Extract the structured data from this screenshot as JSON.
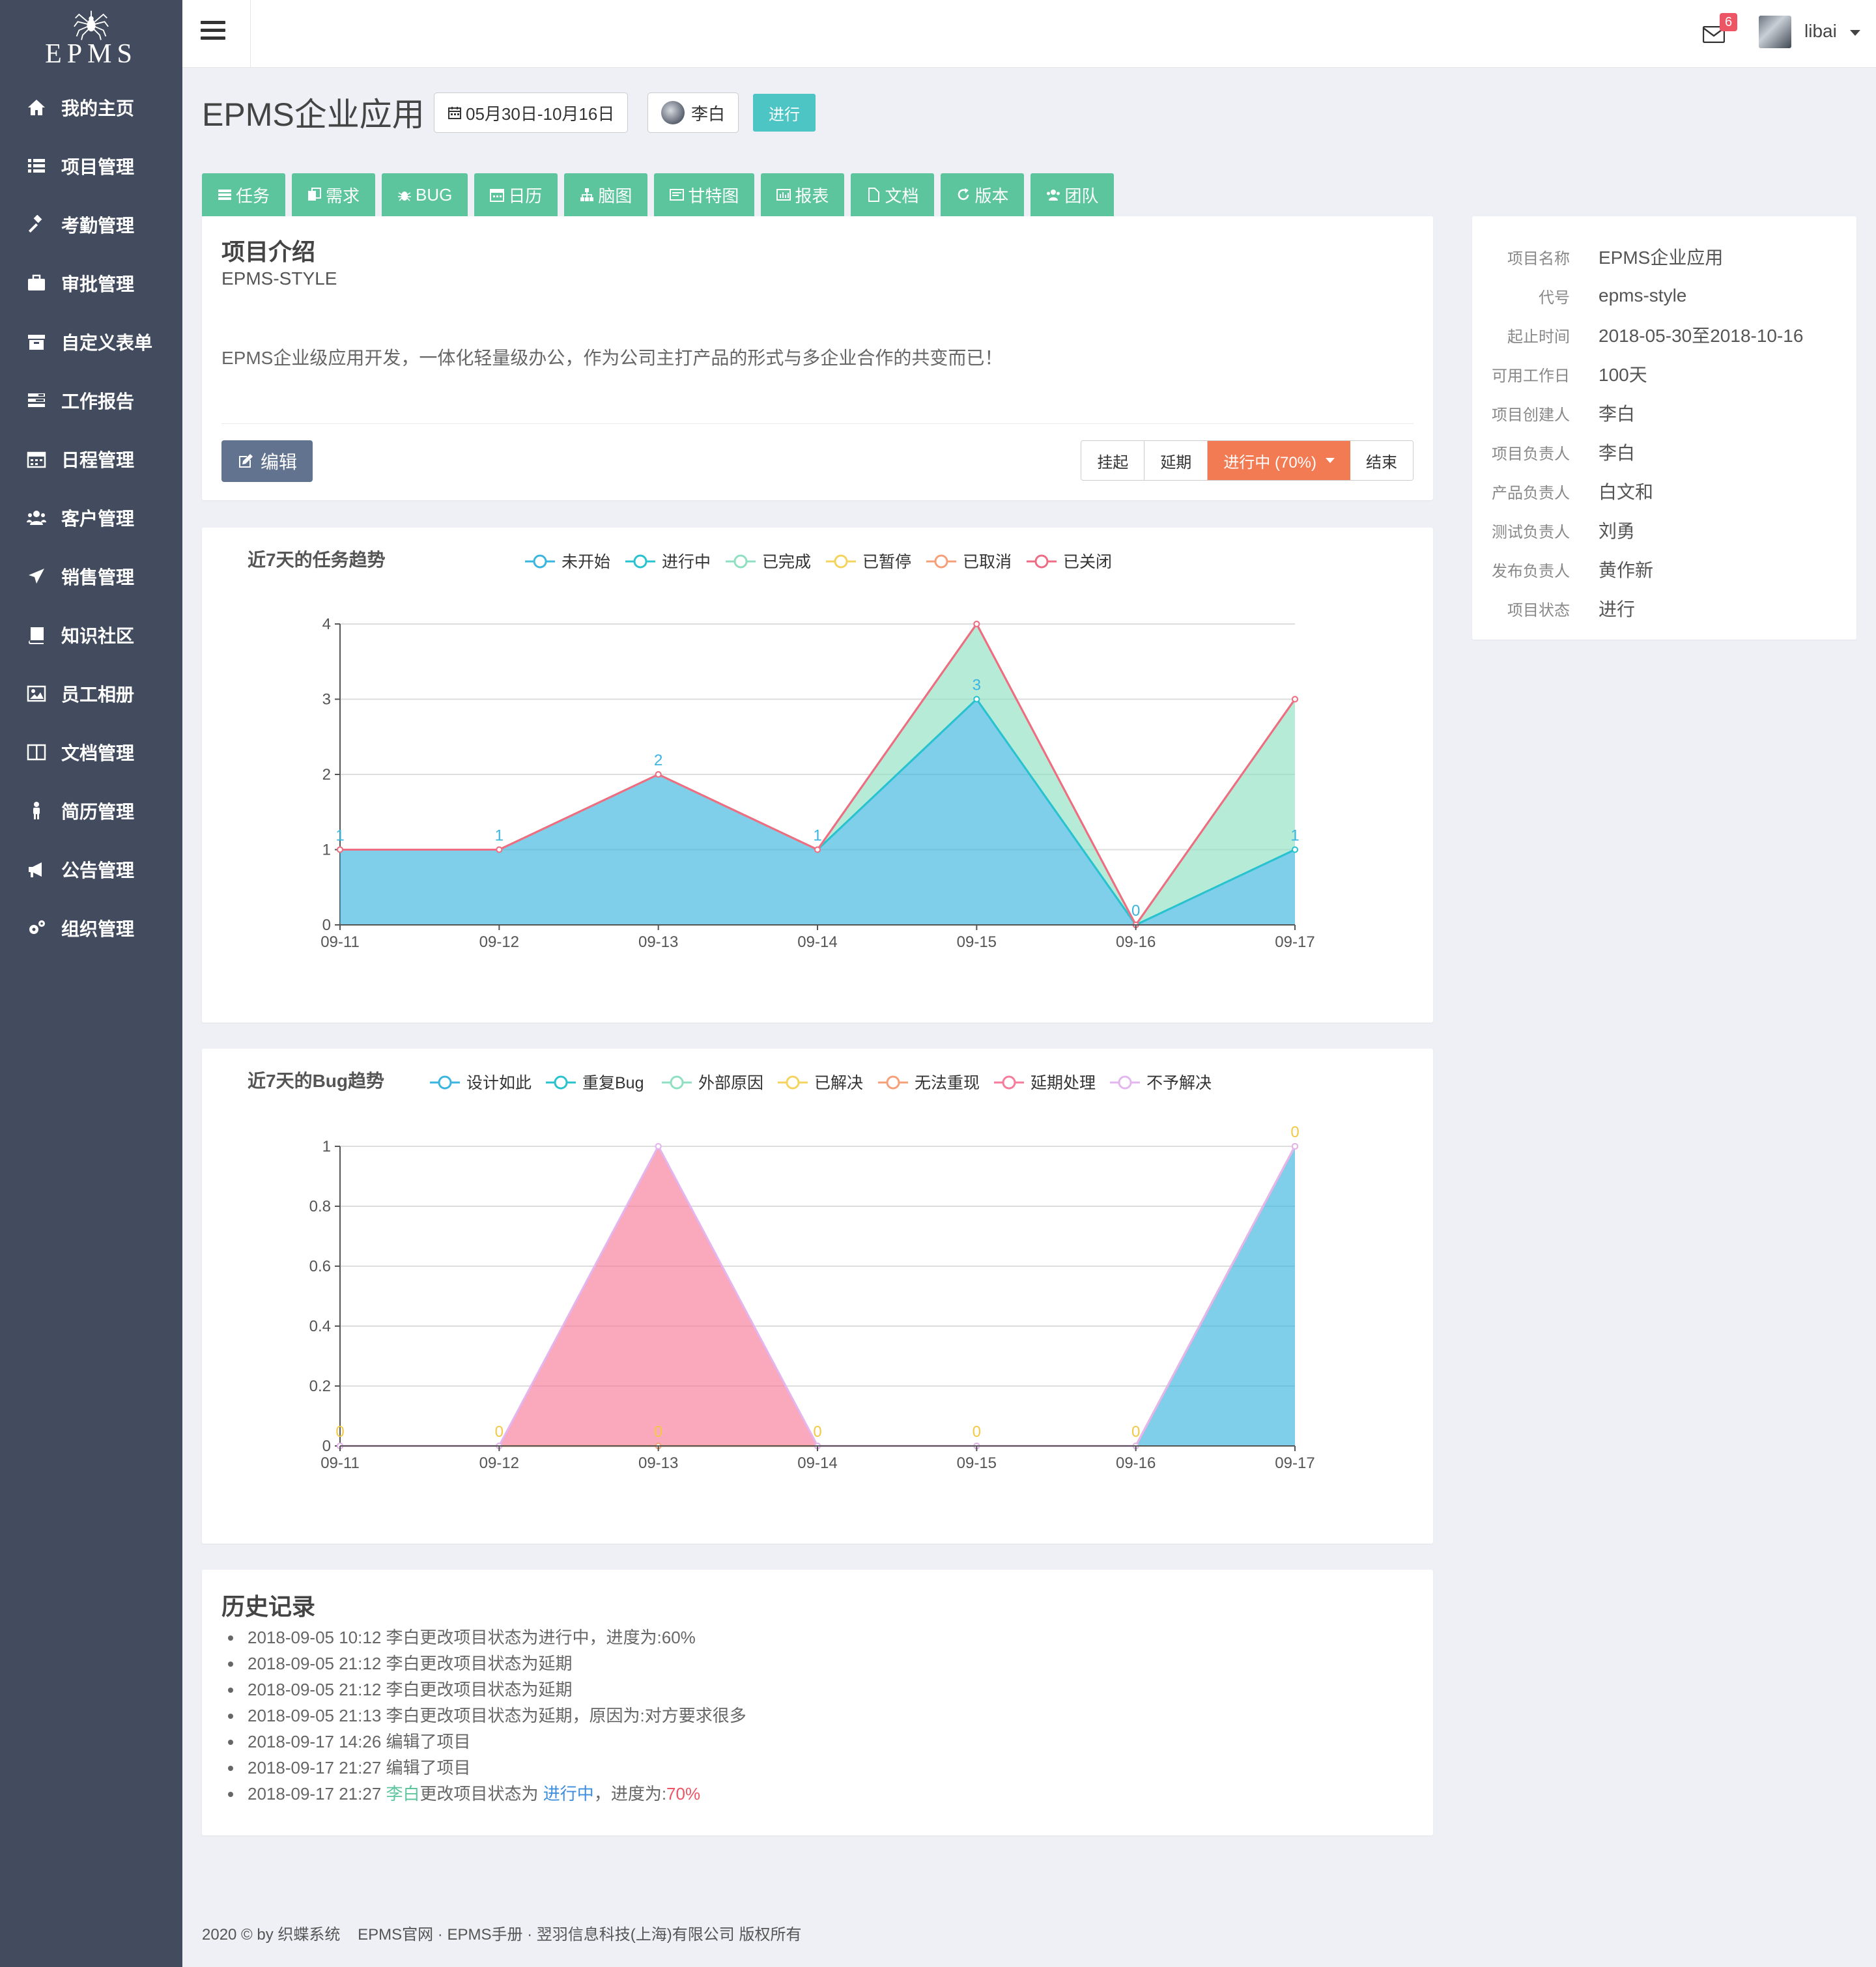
{
  "brand": {
    "logo_text": "EPMS"
  },
  "sidebar": {
    "items": [
      {
        "label": "我的主页",
        "icon": "home-icon"
      },
      {
        "label": "项目管理",
        "icon": "list-icon"
      },
      {
        "label": "考勤管理",
        "icon": "gavel-icon"
      },
      {
        "label": "审批管理",
        "icon": "briefcase-icon"
      },
      {
        "label": "自定义表单",
        "icon": "archive-icon"
      },
      {
        "label": "工作报告",
        "icon": "tasks-icon"
      },
      {
        "label": "日程管理",
        "icon": "calendar-icon"
      },
      {
        "label": "客户管理",
        "icon": "users-icon"
      },
      {
        "label": "销售管理",
        "icon": "plane-icon"
      },
      {
        "label": "知识社区",
        "icon": "book-icon"
      },
      {
        "label": "员工相册",
        "icon": "image-icon"
      },
      {
        "label": "文档管理",
        "icon": "columns-icon"
      },
      {
        "label": "简历管理",
        "icon": "person-icon"
      },
      {
        "label": "公告管理",
        "icon": "bullhorn-icon"
      },
      {
        "label": "组织管理",
        "icon": "cogs-icon"
      }
    ]
  },
  "header": {
    "mail_count": "6",
    "username": "libai"
  },
  "project": {
    "title": "EPMS企业应用",
    "date_range": "05月30日-10月16日",
    "owner": "李白",
    "status": "进行"
  },
  "tabs": [
    {
      "label": "任务",
      "icon": "task-icon"
    },
    {
      "label": "需求",
      "icon": "copy-icon"
    },
    {
      "label": "BUG",
      "icon": "bug-icon"
    },
    {
      "label": "日历",
      "icon": "calendar-icon"
    },
    {
      "label": "脑图",
      "icon": "sitemap-icon"
    },
    {
      "label": "甘特图",
      "icon": "gantt-icon"
    },
    {
      "label": "报表",
      "icon": "bar-chart-icon"
    },
    {
      "label": "文档",
      "icon": "file-icon"
    },
    {
      "label": "版本",
      "icon": "refresh-icon"
    },
    {
      "label": "团队",
      "icon": "team-icon"
    }
  ],
  "intro": {
    "heading": "项目介绍",
    "code": "EPMS-STYLE",
    "description": "EPMS企业级应用开发，一体化轻量级办公，作为公司主打产品的形式与多企业合作的共变而已！",
    "edit_label": "编辑",
    "status_buttons": {
      "suspend": "挂起",
      "delay": "延期",
      "in_progress": "进行中  (70%)",
      "finish": "结束"
    }
  },
  "info": [
    {
      "key": "项目名称",
      "value": "EPMS企业应用"
    },
    {
      "key": "代号",
      "value": "epms-style"
    },
    {
      "key": "起止时间",
      "value": "2018-05-30至2018-10-16"
    },
    {
      "key": "可用工作日",
      "value": "100天"
    },
    {
      "key": "项目创建人",
      "value": "李白"
    },
    {
      "key": "项目负责人",
      "value": "李白"
    },
    {
      "key": "产品负责人",
      "value": "白文和"
    },
    {
      "key": "测试负责人",
      "value": "刘勇"
    },
    {
      "key": "发布负责人",
      "value": "黄作新"
    },
    {
      "key": "项目状态",
      "value": "进行"
    }
  ],
  "chart_data": [
    {
      "type": "area",
      "title": "近7天的任务趋势",
      "x": [
        "09-11",
        "09-12",
        "09-13",
        "09-14",
        "09-15",
        "09-16",
        "09-17"
      ],
      "ylim": [
        0,
        4
      ],
      "yticks": [
        0,
        1,
        2,
        3,
        4
      ],
      "stacked": true,
      "grid": true,
      "legend": "top",
      "series": [
        {
          "name": "未开始",
          "color": "#3ab5e0",
          "values": [
            1,
            1,
            2,
            1,
            3,
            0,
            1
          ],
          "labels": true
        },
        {
          "name": "进行中",
          "color": "#28c3cf",
          "values": [
            0,
            0,
            0,
            0,
            0,
            0,
            0
          ]
        },
        {
          "name": "已完成",
          "color": "#8fe0c1",
          "values": [
            0,
            0,
            0,
            0,
            1,
            0,
            2
          ]
        },
        {
          "name": "已暂停",
          "color": "#f4d35e",
          "values": [
            0,
            0,
            0,
            0,
            0,
            0,
            0
          ]
        },
        {
          "name": "已取消",
          "color": "#f5a078",
          "values": [
            0,
            0,
            0,
            0,
            0,
            0,
            0
          ]
        },
        {
          "name": "已关闭",
          "color": "#ee6c84",
          "values": [
            0,
            0,
            0,
            0,
            0,
            0,
            0
          ]
        }
      ]
    },
    {
      "type": "area",
      "title": "近7天的Bug趋势",
      "x": [
        "09-11",
        "09-12",
        "09-13",
        "09-14",
        "09-15",
        "09-16",
        "09-17"
      ],
      "ylim": [
        0,
        1
      ],
      "yticks": [
        0,
        0.2,
        0.4,
        0.6,
        0.8,
        1
      ],
      "stacked": true,
      "grid": true,
      "legend": "top",
      "series": [
        {
          "name": "设计如此",
          "color": "#3ab5e0",
          "values": [
            0,
            0,
            0,
            0,
            0,
            0,
            1
          ]
        },
        {
          "name": "重复Bug",
          "color": "#28c3cf",
          "values": [
            0,
            0,
            0,
            0,
            0,
            0,
            0
          ]
        },
        {
          "name": "外部原因",
          "color": "#8fe0c1",
          "values": [
            0,
            0,
            0,
            0,
            0,
            0,
            0
          ]
        },
        {
          "name": "已解决",
          "color": "#f4d35e",
          "values": [
            0,
            0,
            0,
            0,
            0,
            0,
            0
          ],
          "labels": true
        },
        {
          "name": "无法重现",
          "color": "#f5a078",
          "values": [
            0,
            0,
            0,
            0,
            0,
            0,
            0
          ]
        },
        {
          "name": "延期处理",
          "color": "#f77b9a",
          "values": [
            0,
            0,
            1,
            0,
            0,
            0,
            0
          ]
        },
        {
          "name": "不予解决",
          "color": "#e3b6f0",
          "values": [
            0,
            0,
            0,
            0,
            0,
            0,
            0
          ]
        }
      ]
    }
  ],
  "history": {
    "heading": "历史记录",
    "items": [
      "2018-09-05 10:12 李白更改项目状态为进行中，进度为:60%",
      "2018-09-05 21:12 李白更改项目状态为延期",
      "2018-09-05 21:12 李白更改项目状态为延期",
      "2018-09-05 21:13 李白更改项目状态为延期，原因为:对方要求很多",
      "2018-09-17 14:26  编辑了项目",
      "2018-09-17 21:27  编辑了项目"
    ],
    "last": {
      "time": "2018-09-17 21:27",
      "user": "李白",
      "action": "更改项目状态为",
      "status": "进行中",
      "sep": "，进度为:",
      "progress": "70%"
    }
  },
  "footer": {
    "copyright": "2020 © by 织蝶系统",
    "links": [
      "EPMS官网",
      "EPMS手册"
    ],
    "company": "翌羽信息科技(上海)有限公司 版权所有"
  }
}
